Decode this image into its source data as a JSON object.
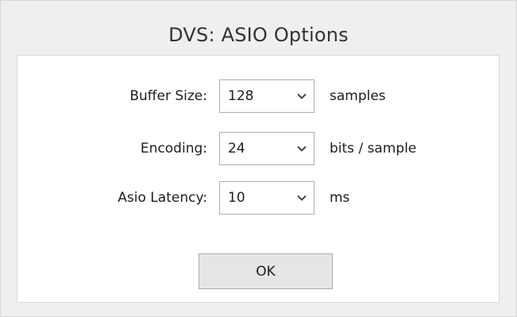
{
  "dialog": {
    "title": "DVS: ASIO Options"
  },
  "settings": [
    {
      "label": "Buffer Size:",
      "value": "128",
      "unit": "samples"
    },
    {
      "label": "Encoding:",
      "value": "24",
      "unit": "bits / sample"
    },
    {
      "label": "Asio Latency:",
      "value": "10",
      "unit": "ms"
    }
  ],
  "actions": {
    "ok_label": "OK"
  },
  "icons": {
    "dropdown": "chevron-down-icon"
  }
}
